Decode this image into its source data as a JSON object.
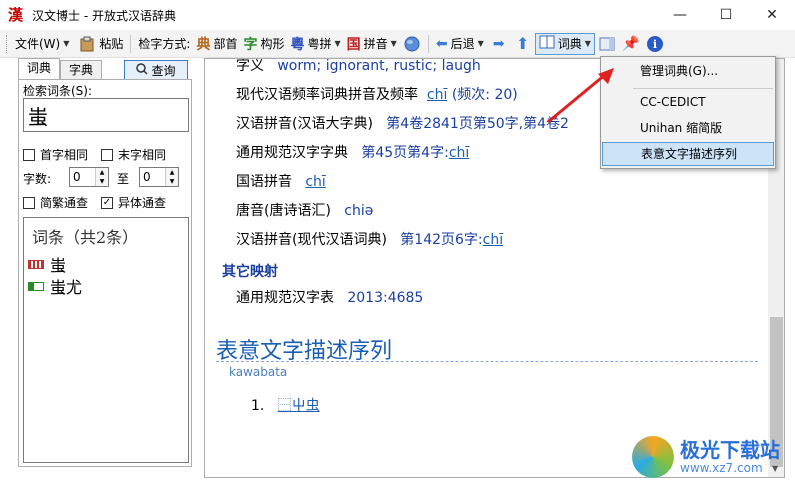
{
  "window": {
    "icon_char": "漢",
    "title": "汉文博士 - 开放式汉语辞典",
    "min": "—",
    "max": "☐",
    "close": "✕"
  },
  "toolbar": {
    "file": "文件(W)",
    "paste": "粘贴",
    "search_mode": "检字方式:",
    "radical_glyph": "典",
    "radical": "部首",
    "shape_glyph": "字",
    "shape": "构形",
    "cantonese_glyph": "粵",
    "cantonese": "粤拼",
    "pinyin_glyph": "国",
    "pinyin": "拼音",
    "back": "后退",
    "dict": "词典"
  },
  "left": {
    "tabs": [
      "词典",
      "字典"
    ],
    "query_button": "查询",
    "search_label": "检索词条(S):",
    "search_value": "蚩",
    "first_same": "首字相同",
    "last_same": "末字相同",
    "char_count": "字数:",
    "to": "至",
    "count_from": "0",
    "count_to": "0",
    "simp_trad": "简繁通查",
    "variant": "异体通查",
    "list_header": "词条（共2条）",
    "entries": [
      "蚩",
      "蚩尤"
    ]
  },
  "content": {
    "r0_label": "字义",
    "r0_value": "worm; ignorant, rustic; laugh",
    "r1_label": "现代汉语频率词典拼音及频率",
    "r1_link": "chī",
    "r1_freq": "(频次: 20)",
    "r2_label": "汉语拼音(汉语大字典)",
    "r2_value": "第4卷2841页第50字,第4卷2",
    "r3_label": "通用规范汉字字典",
    "r3_value": "第45页第4字:",
    "r3_link": "chī",
    "r4_label": "国语拼音",
    "r4_link": "chī",
    "r5_label": "唐音(唐诗语汇)",
    "r5_value": "chiə",
    "r6_label": "汉语拼音(现代汉语词典)",
    "r6_value": "第142页6字:",
    "r6_link": "chī",
    "other_heading": "其它映射",
    "r7_label": "通用规范汉字表",
    "r7_value": "2013:4685",
    "section_title": "表意文字描述序列",
    "source": "kawabata",
    "ids_num": "1.",
    "ids_value": "⿱屮虫"
  },
  "menu": {
    "items": [
      "管理词典(G)...",
      "CC-CEDICT",
      "Unihan 缩简版",
      "表意文字描述序列"
    ]
  },
  "watermark": {
    "title": "极光下载站",
    "url": "www.xz7.com"
  },
  "colors": {
    "accent": "#1a5fb4",
    "highlight": "#cce3f8",
    "arrow": "#e02020"
  }
}
